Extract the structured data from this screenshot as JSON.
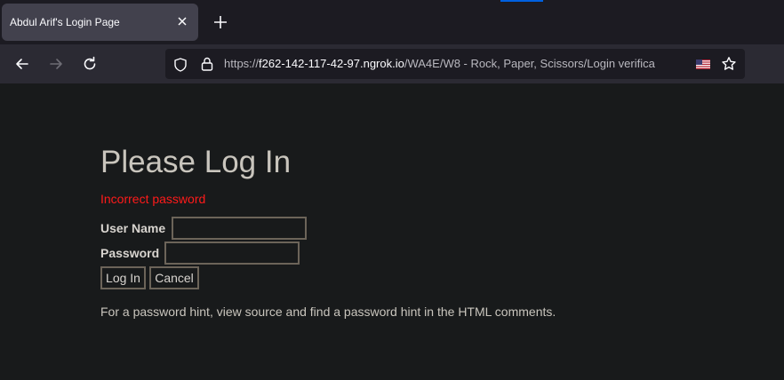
{
  "browser": {
    "tab": {
      "title": "Abdul Arif's Login Page",
      "close_icon": "close-icon"
    },
    "new_tab_icon": "plus-icon",
    "url": {
      "scheme": "https://",
      "host": "f262-142-117-42-97.ngrok.io",
      "path": "/WA4E/W8 - Rock, Paper, Scissors/Login verifica"
    }
  },
  "page": {
    "heading": "Please Log In",
    "error_message": "Incorrect password",
    "username_label": "User Name",
    "username_value": "",
    "password_label": "Password",
    "password_value": "",
    "login_button": "Log In",
    "cancel_button": "Cancel",
    "hint_text": "For a password hint, view source and find a password hint in the HTML comments."
  }
}
